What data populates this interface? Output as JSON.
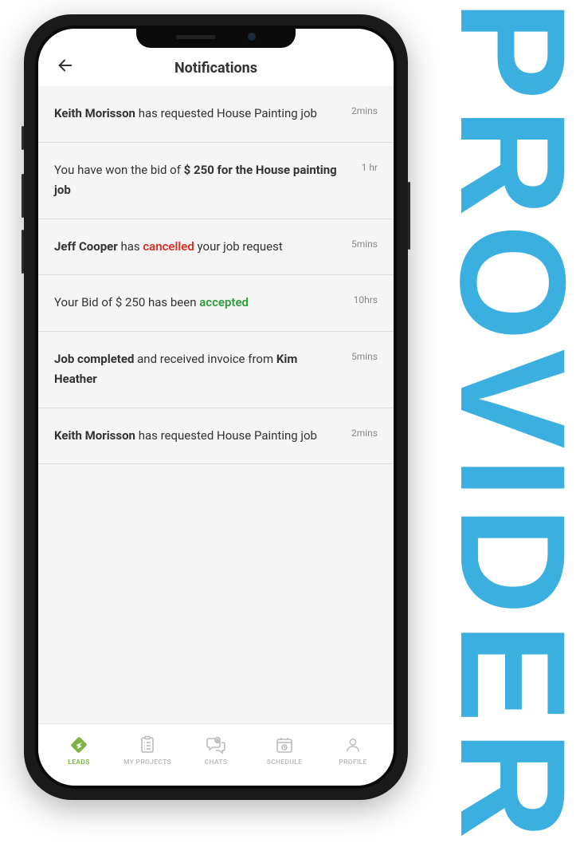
{
  "decor": {
    "provider_label": "PROVIDER"
  },
  "header": {
    "title": "Notifications"
  },
  "notifications": [
    {
      "segments": [
        {
          "text": "Keith Morisson",
          "style": "bold"
        },
        {
          "text": " has requested House Painting job",
          "style": ""
        }
      ],
      "time": "2mins"
    },
    {
      "segments": [
        {
          "text": "You have won the bid of ",
          "style": ""
        },
        {
          "text": "$ 250 for the House painting job",
          "style": "bold"
        }
      ],
      "time": "1 hr"
    },
    {
      "segments": [
        {
          "text": "Jeff Cooper",
          "style": "bold"
        },
        {
          "text": " has ",
          "style": ""
        },
        {
          "text": "cancelled",
          "style": "red"
        },
        {
          "text": " your job request",
          "style": ""
        }
      ],
      "time": "5mins"
    },
    {
      "segments": [
        {
          "text": "Your Bid of $ 250 has been ",
          "style": ""
        },
        {
          "text": "accepted",
          "style": "green"
        }
      ],
      "time": "10hrs"
    },
    {
      "segments": [
        {
          "text": "Job completed",
          "style": "bold"
        },
        {
          "text": " and received invoice from ",
          "style": ""
        },
        {
          "text": "Kim Heather",
          "style": "bold"
        }
      ],
      "time": "5mins"
    },
    {
      "segments": [
        {
          "text": "Keith Morisson",
          "style": "bold"
        },
        {
          "text": " has requested House Painting job",
          "style": ""
        }
      ],
      "time": "2mins"
    }
  ],
  "tabs": [
    {
      "label": "LEADS",
      "icon": "leads-icon",
      "active": true
    },
    {
      "label": "MY PROJECTS",
      "icon": "projects-icon",
      "active": false
    },
    {
      "label": "CHATS",
      "icon": "chats-icon",
      "active": false
    },
    {
      "label": "SCHEDULE",
      "icon": "schedule-icon",
      "active": false
    },
    {
      "label": "PROFILE",
      "icon": "profile-icon",
      "active": false
    }
  ],
  "colors": {
    "accent_green": "#7cb342",
    "text_red": "#d93025",
    "text_green": "#2e9c3a",
    "provider_blue": "#3bb0e0"
  }
}
